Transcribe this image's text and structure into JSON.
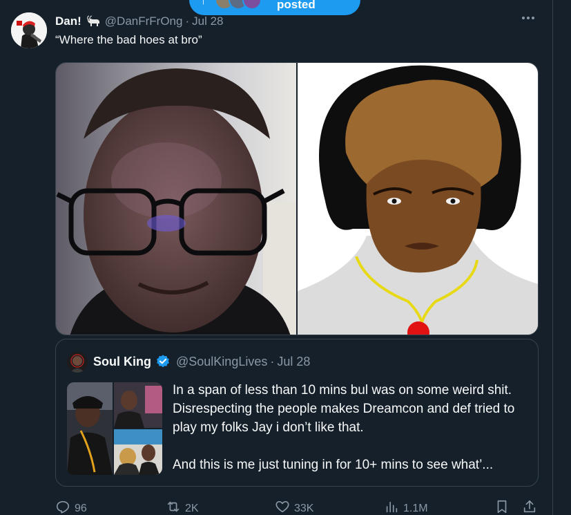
{
  "new_posts_pill": {
    "label": "posted"
  },
  "tweet": {
    "author": {
      "display_name": "Dan!",
      "badge_icon": "goat-emoji-icon",
      "handle": "@DanFrFrOng",
      "separator": "·",
      "date": "Jul 28"
    },
    "text": "“Where the bad hoes at bro”",
    "media": [
      {
        "description_icon": "selfie-photo"
      },
      {
        "description_icon": "cartoon-drawing"
      }
    ],
    "quote": {
      "display_name": "Soul King",
      "verified": true,
      "handle": "@SoulKingLives",
      "separator": "·",
      "date": "Jul 28",
      "text_1": "In a span of less than 10 mins bul was on some weird shit. Disrespecting the people makes Dreamcon and def tried to play my folks Jay i don’t like that.",
      "text_2": "And this is me just tuning in for 10+ mins to see what’..."
    },
    "actions": {
      "replies": "96",
      "reposts": "2K",
      "likes": "33K",
      "views": "1.1M"
    }
  },
  "colors": {
    "background": "#15202b",
    "text_primary": "#f7f9f9",
    "text_secondary": "#8b98a5",
    "border": "#38444d",
    "accent": "#1d9bf0"
  }
}
